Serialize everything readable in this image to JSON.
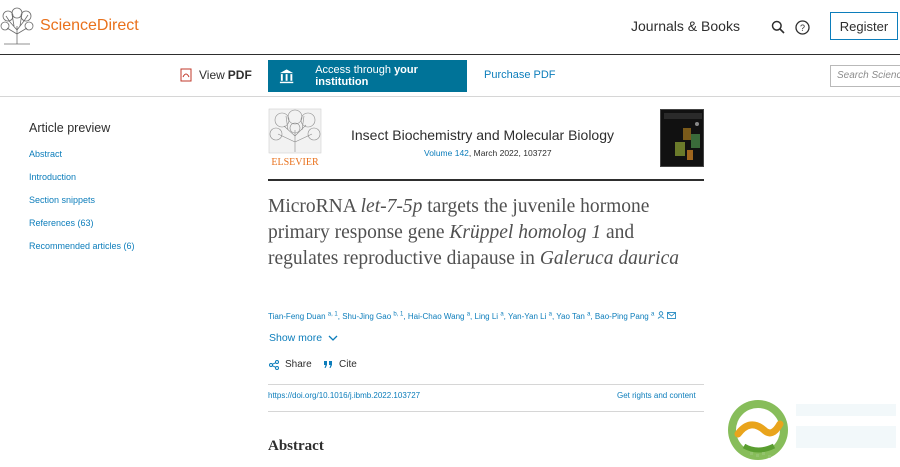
{
  "header": {
    "brand": "ScienceDirect",
    "journals_books": "Journals & Books",
    "register": "Register"
  },
  "toolbar": {
    "view": "View",
    "pdf": "PDF",
    "access_prefix": "Access through ",
    "access_bold": "your institution",
    "purchase": "Purchase PDF",
    "search_placeholder": "Search ScienceDirect"
  },
  "sidebar": {
    "heading": "Article preview",
    "items": [
      {
        "label": "Abstract"
      },
      {
        "label": "Introduction"
      },
      {
        "label": "Section snippets"
      },
      {
        "label": "References (63)"
      },
      {
        "label": "Recommended articles (6)"
      }
    ]
  },
  "journal": {
    "publisher": "ELSEVIER",
    "title": "Insect Biochemistry and Molecular Biology",
    "volume_link": "Volume 142",
    "date_number": ", March 2022, 103727"
  },
  "article": {
    "title_part1": "MicroRNA ",
    "title_italic1": "let-7-5p",
    "title_part2": " targets the juvenile hormone primary response gene ",
    "title_italic2": "Krüppel homolog 1",
    "title_part3": " and regulates reproductive diapause in ",
    "title_italic3": "Galeruca daurica",
    "authors": [
      {
        "name": "Tian-Feng Duan",
        "sup": "a, 1"
      },
      {
        "name": "Shu-Jing Gao",
        "sup": "b, 1"
      },
      {
        "name": "Hai-Chao Wang",
        "sup": "a"
      },
      {
        "name": "Ling Li",
        "sup": "a"
      },
      {
        "name": "Yan-Yan Li",
        "sup": "a"
      },
      {
        "name": "Yao Tan",
        "sup": "a"
      },
      {
        "name": "Bao-Ping Pang",
        "sup": "a"
      }
    ],
    "show_more": "Show more",
    "share": "Share",
    "cite": "Cite",
    "doi": "https://doi.org/10.1016/j.ibmb.2022.103727",
    "rights": "Get rights and content",
    "abstract_heading": "Abstract"
  },
  "colors": {
    "brand_orange": "#e9711c",
    "link_blue": "#0c7dbb",
    "access_teal": "#007398"
  }
}
